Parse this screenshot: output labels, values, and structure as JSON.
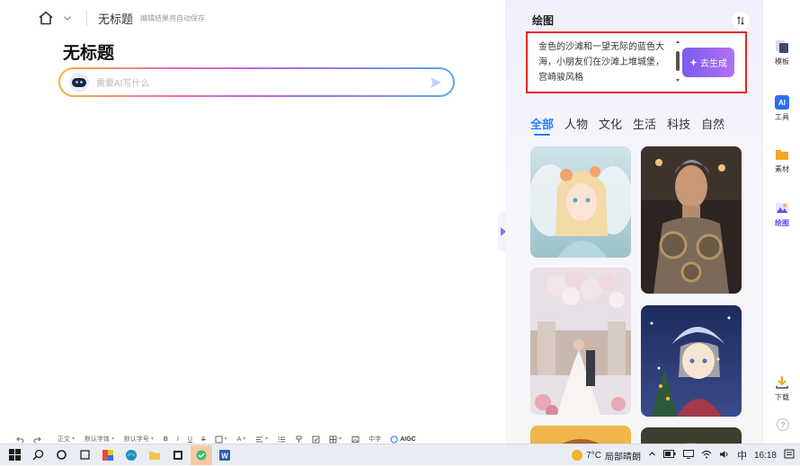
{
  "editor": {
    "header_title": "无标题",
    "autosave_note": "编辑结果将自动保存",
    "doc_title": "无标题",
    "ai_placeholder": "需要AI写什么"
  },
  "toolbar": {
    "body_style": "正文",
    "default_font": "默认字体",
    "default_size": "默认字号",
    "bold": "B",
    "italic": "I",
    "underline": "U",
    "strike": "S",
    "font_color": "A",
    "aigc": "AIGC",
    "zh_label": "中字"
  },
  "panel": {
    "title": "绘图",
    "prompt_text": "金色的沙滩和一望无际的蓝色大海，小朋友们在沙滩上堆城堡，宫崎骏风格",
    "generate_label": "去生成",
    "categories": [
      {
        "label": "全部",
        "active": true
      },
      {
        "label": "人物",
        "active": false
      },
      {
        "label": "文化",
        "active": false
      },
      {
        "label": "生活",
        "active": false
      },
      {
        "label": "科技",
        "active": false
      },
      {
        "label": "自然",
        "active": false
      }
    ]
  },
  "iconbar": {
    "items": [
      {
        "label": "模板",
        "icon": "template-icon"
      },
      {
        "label": "工具",
        "icon": "ai-tool-icon"
      },
      {
        "label": "素材",
        "icon": "folder-icon"
      },
      {
        "label": "绘图",
        "icon": "drawing-icon",
        "active": true
      },
      {
        "label": "下载",
        "icon": "download-icon"
      }
    ],
    "help": "?"
  },
  "taskbar": {
    "temperature": "7°C",
    "weather": "局部晴朗",
    "ime": "中",
    "time": "16:18"
  },
  "colors": {
    "accent": "#2d7cff",
    "brand_purple": "#7c5cf0",
    "highlight_red": "#e8261f"
  }
}
